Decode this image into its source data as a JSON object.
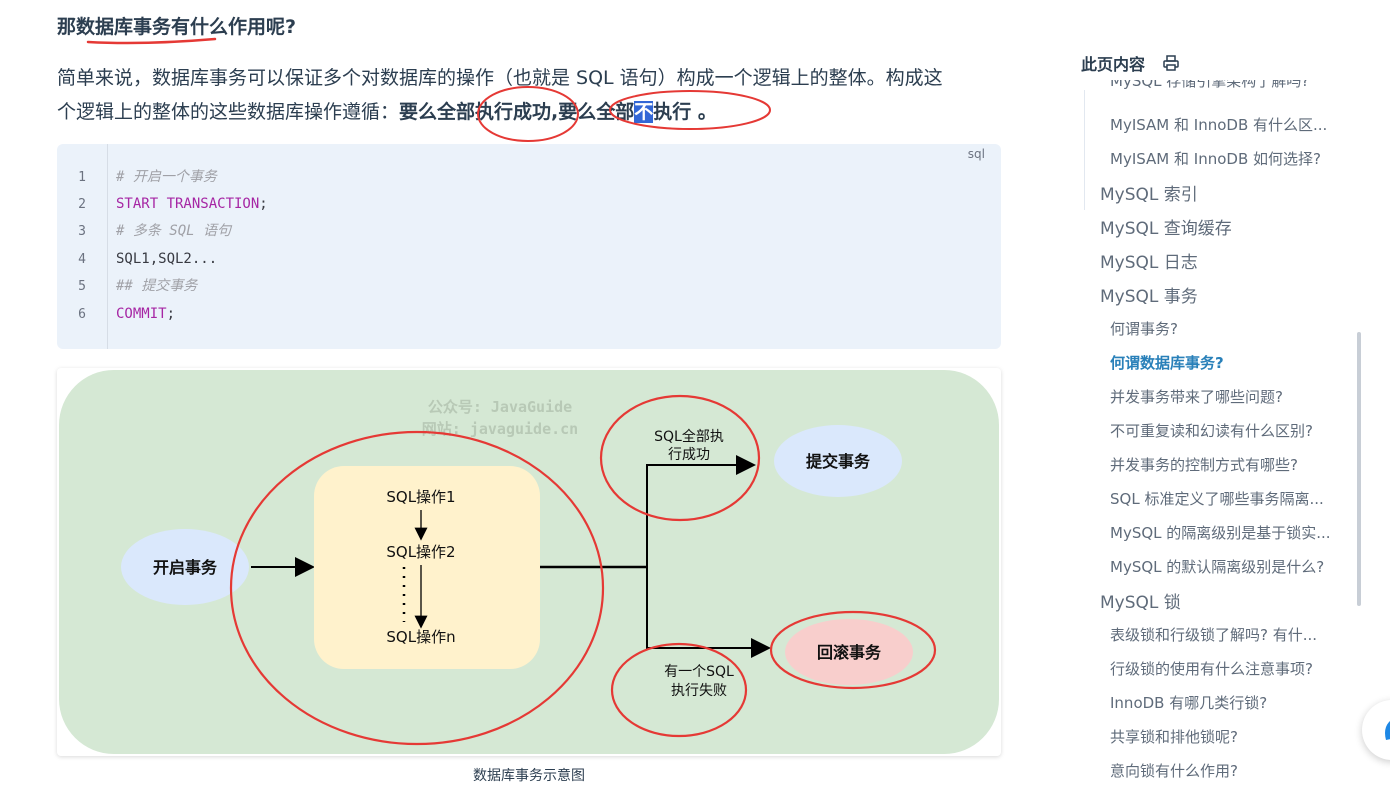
{
  "article": {
    "heading": "那数据库事务有什么作用呢?",
    "para_line1": "简单来说，数据库事务可以保证多个对数据库的操作（也就是 SQL 语句）构成一个逻辑上的整体。构成这",
    "para_line2_plain": "个逻辑上的整体的这些数据库操作遵循：",
    "para_bold_1": "要么全部执行成功,要么全部",
    "para_highlight": "不",
    "para_bold_2": "执行 。"
  },
  "code": {
    "lang": "sql",
    "lines": [
      {
        "num": "1",
        "text": "# 开启一个事务"
      },
      {
        "num": "2",
        "text_kw": "START TRANSACTION",
        "text_rest": ";"
      },
      {
        "num": "3",
        "text": "# 多条 SQL 语句"
      },
      {
        "num": "4",
        "text": "SQL1,SQL2..."
      },
      {
        "num": "5",
        "text": "## 提交事务"
      },
      {
        "num": "6",
        "text_kw": "COMMIT",
        "text_rest": ";"
      }
    ]
  },
  "diagram": {
    "watermark_1": "公众号: JavaGuide",
    "watermark_2": "网站: javaguide.cn",
    "start": "开启事务",
    "op1": "SQL操作1",
    "op2": "SQL操作2",
    "opn": "SQL操作n",
    "success_1": "SQL全部执",
    "success_2": "行成功",
    "commit": "提交事务",
    "fail_1": "有一个SQL",
    "fail_2": "执行失败",
    "rollback": "回滚事务",
    "caption": "数据库事务示意图",
    "colors": {
      "panel": "#d5e8d4",
      "ops_box": "#fff2cc",
      "ellipse_blue": "#dae8fc",
      "ellipse_red": "#f8cecc",
      "annotation": "#e53935"
    }
  },
  "toc": {
    "title": "此页内容",
    "print_icon": "printer-icon",
    "cut_top": "MySQL 存储引擎架构了解吗?",
    "items": [
      {
        "text": "MyISAM 和 InnoDB 有什么区...",
        "level": 3
      },
      {
        "text": "MyISAM 和 InnoDB 如何选择?",
        "level": 3
      },
      {
        "text": "MySQL 索引",
        "level": 2
      },
      {
        "text": "MySQL 查询缓存",
        "level": 2
      },
      {
        "text": "MySQL 日志",
        "level": 2
      },
      {
        "text": "MySQL 事务",
        "level": 2
      },
      {
        "text": "何谓事务?",
        "level": 3
      },
      {
        "text": "何谓数据库事务?",
        "level": 3,
        "active": true
      },
      {
        "text": "并发事务带来了哪些问题?",
        "level": 3
      },
      {
        "text": "不可重复读和幻读有什么区别?",
        "level": 3
      },
      {
        "text": "并发事务的控制方式有哪些?",
        "level": 3
      },
      {
        "text": "SQL 标准定义了哪些事务隔离...",
        "level": 3
      },
      {
        "text": "MySQL 的隔离级别是基于锁实...",
        "level": 3
      },
      {
        "text": "MySQL 的默认隔离级别是什么?",
        "level": 3
      },
      {
        "text": "MySQL 锁",
        "level": 2
      },
      {
        "text": "表级锁和行级锁了解吗? 有什...",
        "level": 3
      },
      {
        "text": "行级锁的使用有什么注意事项?",
        "level": 3
      },
      {
        "text": "InnoDB 有哪几类行锁?",
        "level": 3
      },
      {
        "text": "共享锁和排他锁呢?",
        "level": 3
      },
      {
        "text": "意向锁有什么作用?",
        "level": 3
      }
    ]
  }
}
